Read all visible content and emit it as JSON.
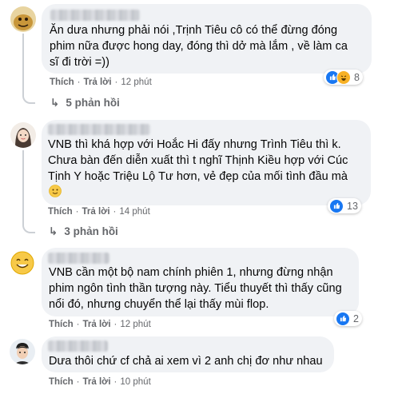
{
  "comments": [
    {
      "lines": [
        "Ăn dưa nhưng phải nói ,Trịnh Tiêu cô có thể đừng đóng",
        "phim nữa được hong day, đóng thì dở mà lắm , về làm ca",
        "sĩ đi trời =))"
      ],
      "like_label": "Thích",
      "reply_label": "Trả lời",
      "time": "12 phút",
      "reaction_count": "8",
      "replies_label": "5 phản hồi"
    },
    {
      "lines": [
        "VNB thì khá hợp với Hoắc Hi đấy nhưng Trình Tiêu thì k.",
        "Chưa bàn đến diễn xuất thì t nghĩ Thịnh Kiều hợp với Cúc",
        "Tịnh Y hoặc Triệu Lộ Tư hơn, vẻ đẹp của mối tình đầu mà"
      ],
      "emoji": "slightly-smiling-face",
      "like_label": "Thích",
      "reply_label": "Trả lời",
      "time": "14 phút",
      "reaction_count": "13",
      "replies_label": "3 phản hồi"
    },
    {
      "lines": [
        "VNB cần một bộ nam chính phiên 1, nhưng đừng nhận",
        "phim ngôn tình thần tượng này. Tiểu thuyết thì thấy cũng",
        "nổi đó, nhưng chuyển thể lại thấy mùi flop."
      ],
      "like_label": "Thích",
      "reply_label": "Trả lời",
      "time": "12 phút",
      "reaction_count": "2"
    },
    {
      "lines": [
        "Dưa thôi chứ cf chả ai xem vì 2 anh chị đơ như nhau"
      ],
      "like_label": "Thích",
      "reply_label": "Trả lời",
      "time": "10 phút"
    }
  ],
  "colors": {
    "bubble": "#f0f2f5",
    "meta_text": "#65676b",
    "like_blue": "#1877f2",
    "haha_yellow": "#f7b125"
  }
}
